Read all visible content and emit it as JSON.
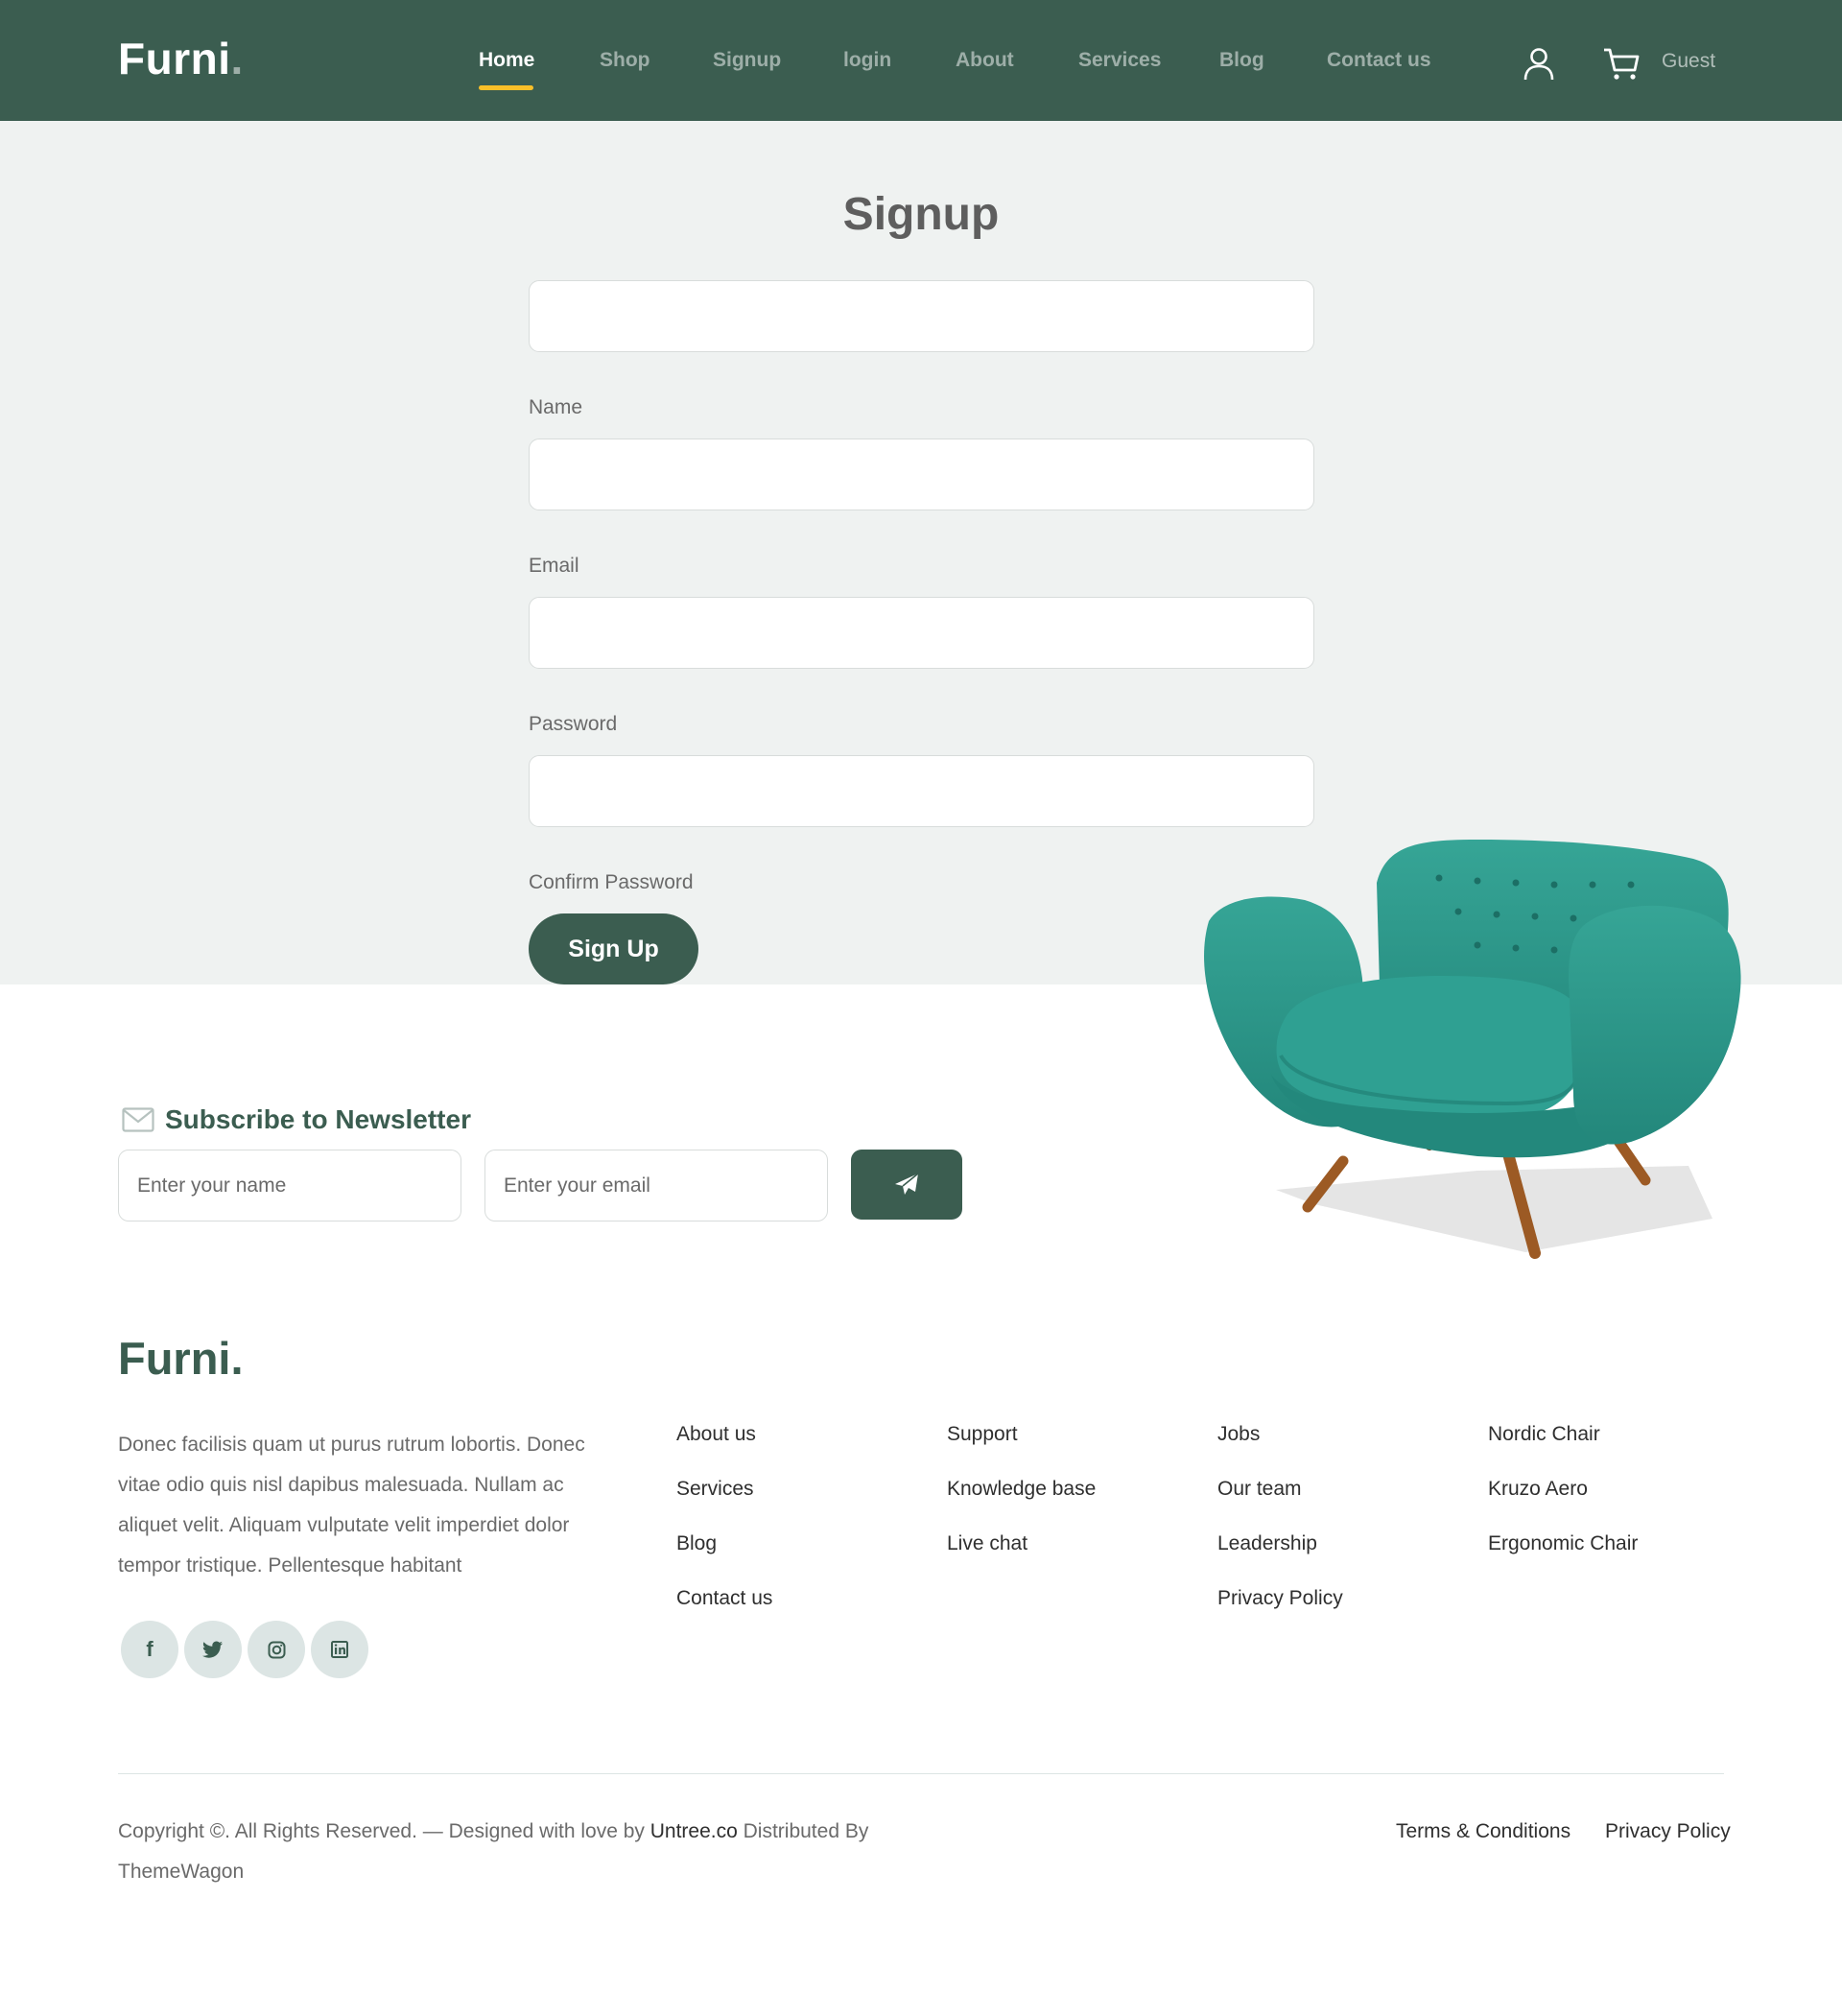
{
  "header": {
    "brand": "Furni",
    "brand_dot": ".",
    "nav": [
      "Home",
      "Shop",
      "Signup",
      "login",
      "About",
      "Services",
      "Blog",
      "Contact us"
    ],
    "active_nav": "Home",
    "user_icon": "user-icon",
    "cart_icon": "cart-icon",
    "guest_label": "Guest"
  },
  "form": {
    "title": "Signup",
    "labels": {
      "name": "Name",
      "email": "Email",
      "password": "Password",
      "confirm_password": "Confirm Password"
    },
    "submit_label": "Sign Up"
  },
  "newsletter": {
    "icon": "mail-icon",
    "title": "Subscribe to Newsletter",
    "name_placeholder": "Enter your name",
    "email_placeholder": "Enter your email",
    "send_icon": "paper-plane-icon"
  },
  "footer": {
    "brand": "Furni.",
    "description": "Donec facilisis quam ut purus rutrum lobortis. Donec vitae odio quis nisl dapibus malesuada. Nullam ac aliquet velit. Aliquam vulputate velit imperdiet dolor tempor tristique. Pellentesque habitant",
    "social": [
      {
        "name": "facebook-icon",
        "glyph": "f"
      },
      {
        "name": "twitter-icon",
        "glyph": ""
      },
      {
        "name": "instagram-icon",
        "glyph": ""
      },
      {
        "name": "linkedin-icon",
        "glyph": ""
      }
    ],
    "columns": [
      [
        "About us",
        "Services",
        "Blog",
        "Contact us"
      ],
      [
        "Support",
        "Knowledge base",
        "Live chat"
      ],
      [
        "Jobs",
        "Our team",
        "Leadership",
        "Privacy Policy"
      ],
      [
        "Nordic Chair",
        "Kruzo Aero",
        "Ergonomic Chair"
      ]
    ],
    "copyright_prefix": "Copyright ©. All Rights Reserved. — Designed with love by",
    "designer": "Untree.co",
    "distributed_by": "Distributed By",
    "distributor": "ThemeWagon",
    "legal": [
      "Terms & Conditions",
      "Privacy Policy"
    ]
  },
  "colors": {
    "primary": "#3b5d50",
    "accent": "#f9bf29",
    "section_bg": "#eff2f1",
    "sofa": "#2e9b8f"
  }
}
